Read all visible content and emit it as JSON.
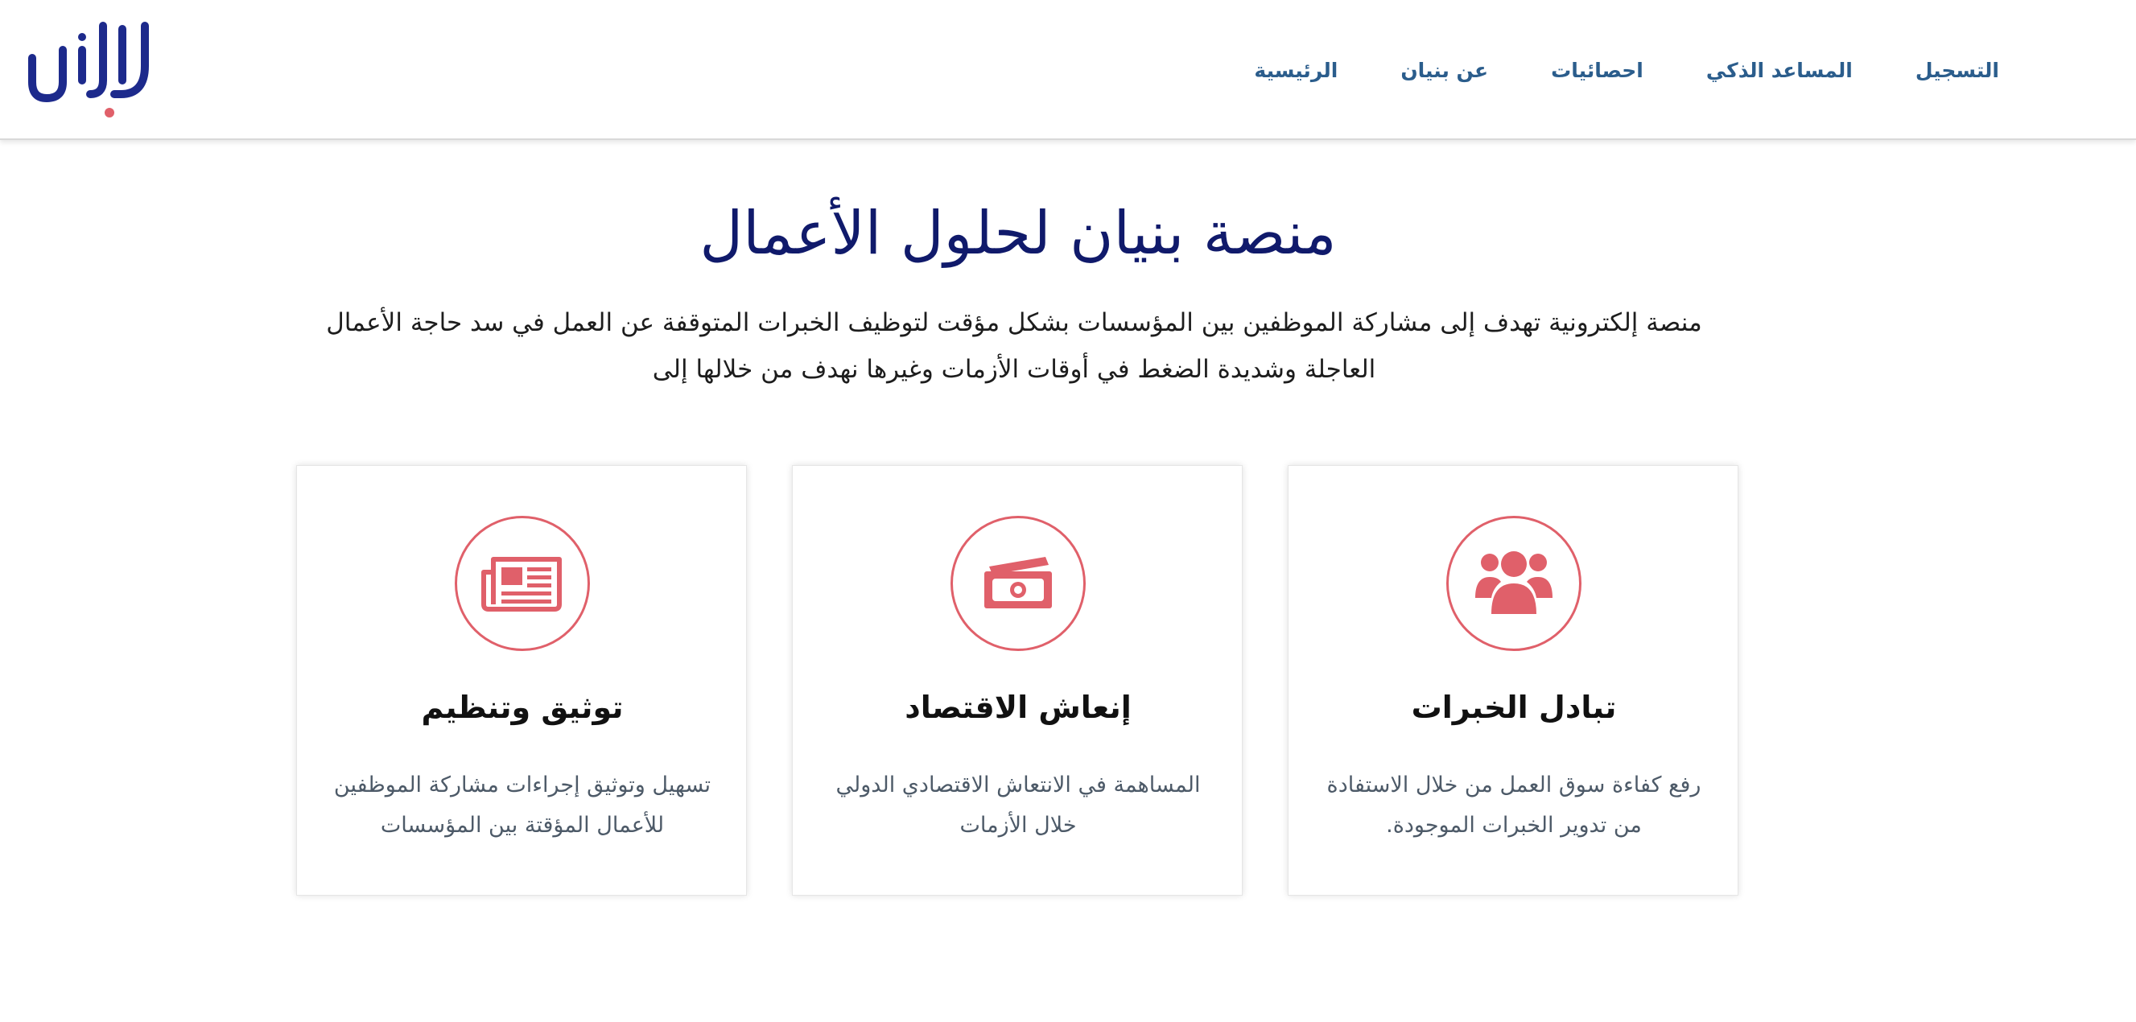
{
  "header": {
    "logo_text": "بنيان",
    "nav": [
      {
        "label": "الرئيسية"
      },
      {
        "label": "عن بنيان"
      },
      {
        "label": "احصائيات"
      },
      {
        "label": "المساعد الذكي"
      },
      {
        "label": "التسجيل"
      }
    ]
  },
  "hero": {
    "title": "منصة بنيان لحلول الأعمال",
    "description": "منصة إلكترونية تهدف إلى مشاركة الموظفين بين المؤسسات بشكل مؤقت لتوظيف الخبرات المتوقفة عن العمل في سد حاجة الأعمال العاجلة وشديدة الضغط في أوقات الأزمات وغيرها نهدف من خلالها إلى"
  },
  "cards": [
    {
      "icon": "users-icon",
      "title": "تبادل الخبرات",
      "text": "رفع كفاءة سوق العمل من خلال الاستفادة من تدوير الخبرات الموجودة."
    },
    {
      "icon": "money-icon",
      "title": "إنعاش الاقتصاد",
      "text": "المساهمة في الانتعاش الاقتصادي الدولي خلال الأزمات"
    },
    {
      "icon": "newspaper-icon",
      "title": "توثيق وتنظيم",
      "text": "تسهيل وتوثيق إجراءات مشاركة الموظفين للأعمال المؤقتة بين المؤسسات"
    }
  ],
  "colors": {
    "brand_blue": "#101a6b",
    "nav_blue": "#2b5d8c",
    "accent_red": "#e0606a"
  }
}
